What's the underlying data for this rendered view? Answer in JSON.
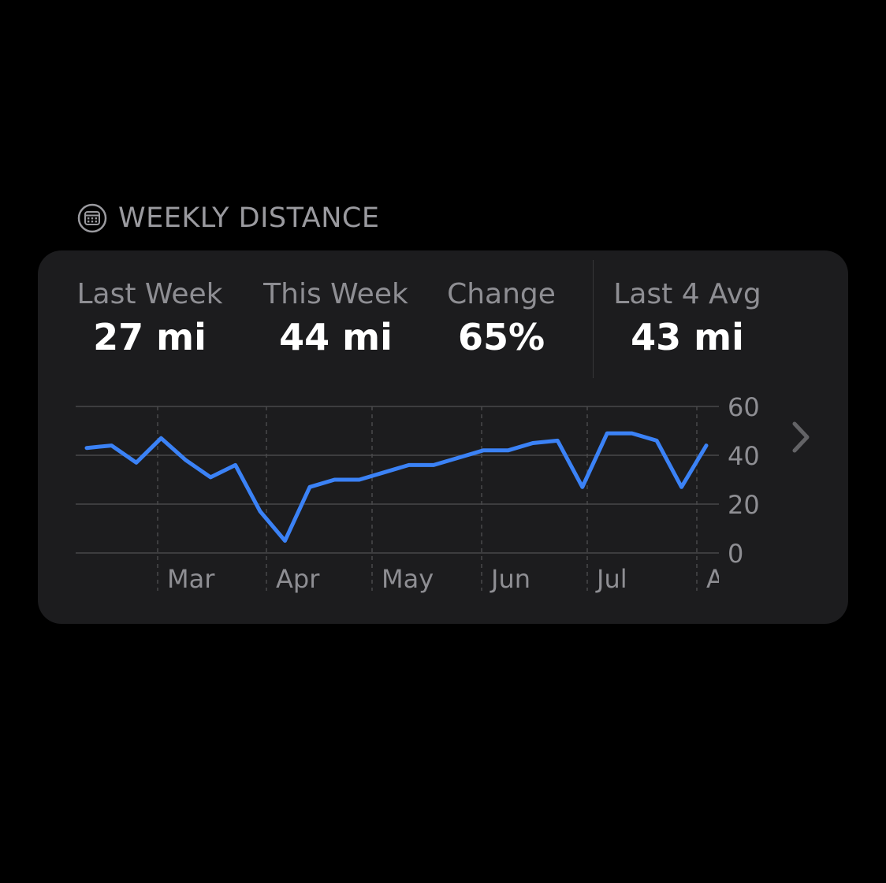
{
  "header": {
    "icon": "calendar-icon",
    "title": "WEEKLY DISTANCE"
  },
  "stats": {
    "last_week": {
      "label": "Last Week",
      "value": "27 mi"
    },
    "this_week": {
      "label": "This Week",
      "value": "44 mi"
    },
    "change": {
      "label": "Change",
      "value": "65%"
    },
    "last4_avg": {
      "label": "Last 4 Avg",
      "value": "43 mi"
    }
  },
  "navigation": {
    "icon": "chevron-right-icon"
  },
  "colors": {
    "background": "#000000",
    "card": "#1c1c1e",
    "line": "#3b82f6",
    "label": "#8e8e93",
    "value": "#ffffff",
    "grid": "#48484a"
  },
  "chart_data": {
    "type": "line",
    "title": "",
    "xlabel": "",
    "ylabel": "",
    "ylim": [
      0,
      60
    ],
    "y_ticks": [
      "0",
      "20",
      "40",
      "60"
    ],
    "grid": true,
    "x_tick_labels": [
      "Mar",
      "Apr",
      "May",
      "Jun",
      "Jul",
      "A"
    ],
    "series": [
      {
        "values": [
          43,
          44,
          37,
          47,
          38,
          31,
          36,
          17,
          5,
          27,
          30,
          30,
          33,
          36,
          36,
          39,
          42,
          42,
          45,
          46,
          27,
          49,
          49,
          46,
          27,
          44
        ]
      }
    ]
  }
}
